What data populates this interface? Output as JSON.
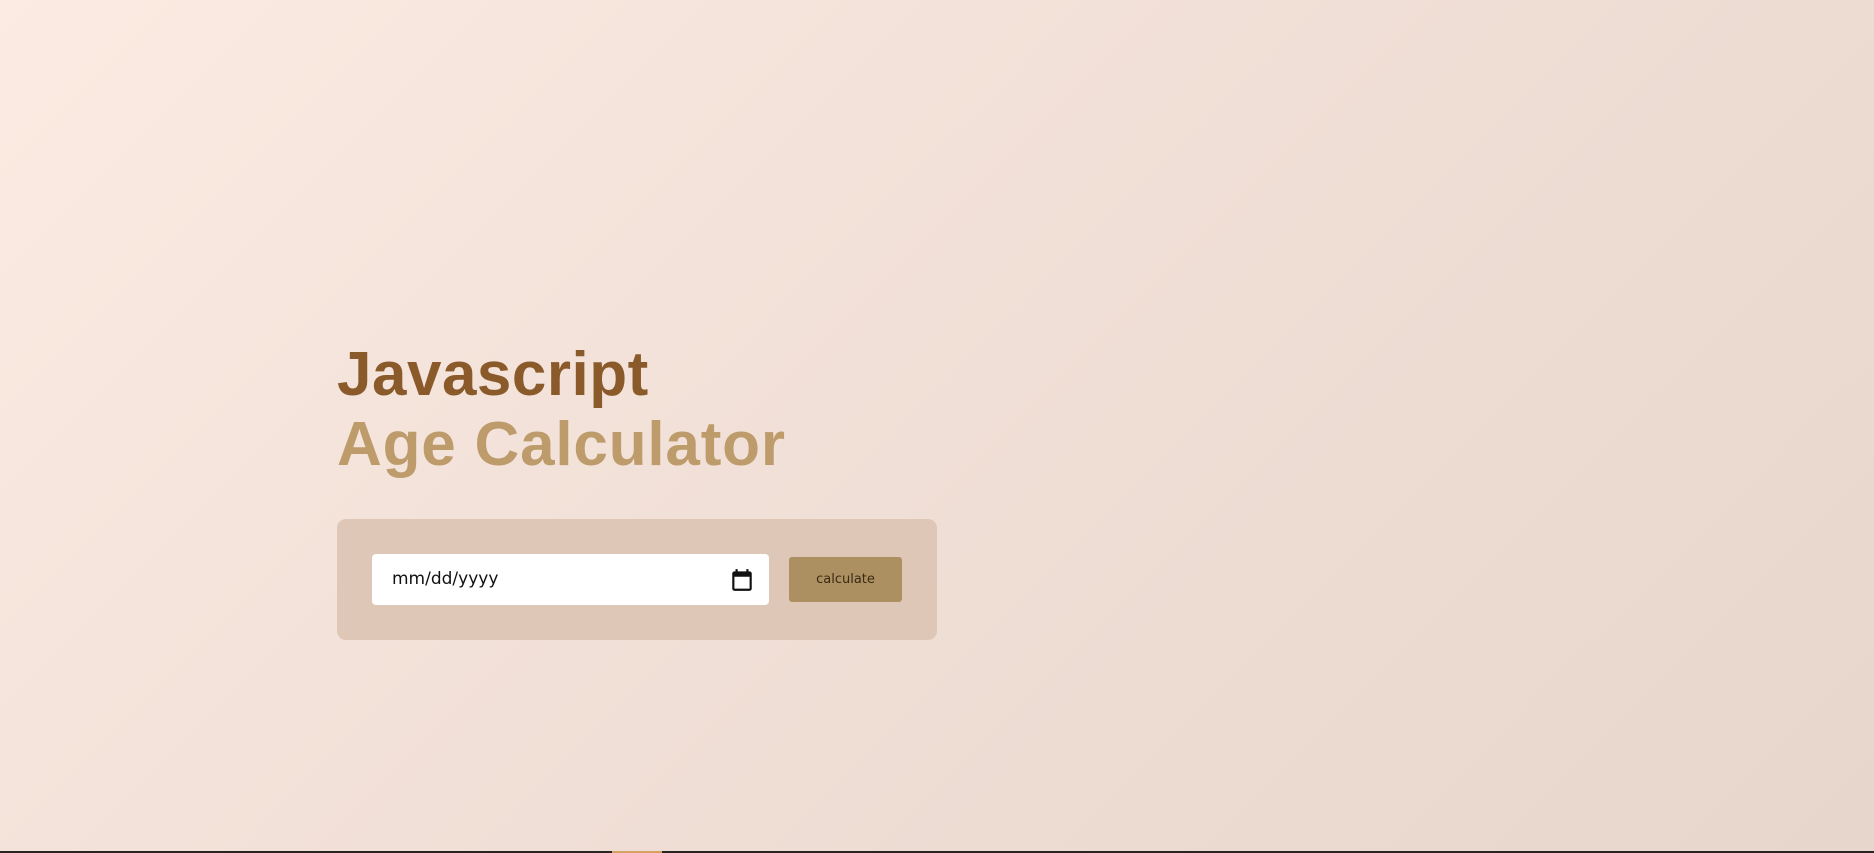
{
  "header": {
    "title_line1": "Javascript",
    "title_line2": "Age Calculator"
  },
  "form": {
    "date_placeholder": "mm/dd/yyyy",
    "calendar_icon": "calendar-icon",
    "button_label": "calculate"
  },
  "colors": {
    "title_primary": "#8b5a2b",
    "title_secondary": "#bd9b6b",
    "panel_background": "#dfc7b7",
    "button_background": "#ad9061"
  }
}
